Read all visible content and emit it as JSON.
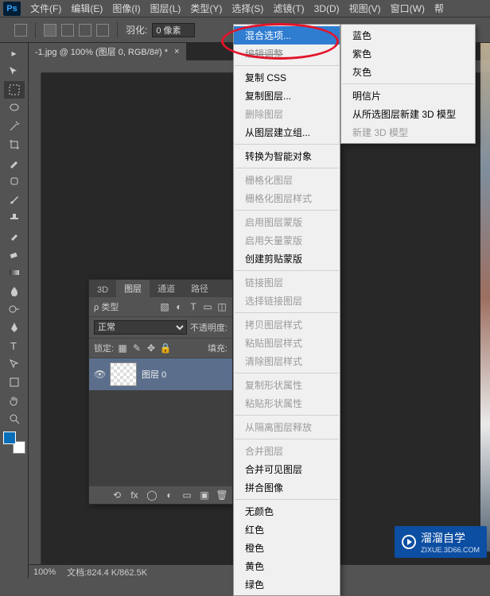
{
  "menubar": {
    "items": [
      "文件(F)",
      "编辑(E)",
      "图像(I)",
      "图层(L)",
      "类型(Y)",
      "选择(S)",
      "滤镜(T)",
      "3D(D)",
      "视图(V)",
      "窗口(W)",
      "帮"
    ]
  },
  "optbar": {
    "feather_label": "羽化:",
    "feather_value": "0 像素"
  },
  "doc": {
    "tab_title": "-1.jpg @ 100% (图层 0, RGB/8#) *"
  },
  "layers_panel": {
    "tabs": [
      "3D",
      "图层",
      "通道",
      "路径"
    ],
    "active_tab": 1,
    "kind_label": "ρ 类型",
    "blend_label": "正常",
    "opacity_label": "不透明度:",
    "lock_label": "锁定:",
    "fill_label": "填充:",
    "layer0_name": "图层 0"
  },
  "statusbar": {
    "zoom": "100%",
    "docinfo_label": "文档:",
    "docinfo_value": "824.4 K/862.5K"
  },
  "ctx_left": {
    "highlight": "混合选项...",
    "cutoff": "编辑调整",
    "items": [
      {
        "t": "复制 CSS",
        "d": false
      },
      {
        "t": "复制图层...",
        "d": false
      },
      {
        "t": "删除图层",
        "d": true
      },
      {
        "t": "从图层建立组...",
        "d": false
      },
      {
        "sep": true
      },
      {
        "t": "转换为智能对象",
        "d": false
      },
      {
        "sep": true
      },
      {
        "t": "栅格化图层",
        "d": true
      },
      {
        "t": "栅格化图层样式",
        "d": true
      },
      {
        "sep": true
      },
      {
        "t": "启用图层蒙版",
        "d": true
      },
      {
        "t": "启用矢量蒙版",
        "d": true
      },
      {
        "t": "创建剪贴蒙版",
        "d": false
      },
      {
        "sep": true
      },
      {
        "t": "链接图层",
        "d": true
      },
      {
        "t": "选择链接图层",
        "d": true
      },
      {
        "sep": true
      },
      {
        "t": "拷贝图层样式",
        "d": true
      },
      {
        "t": "粘贴图层样式",
        "d": true
      },
      {
        "t": "清除图层样式",
        "d": true
      },
      {
        "sep": true
      },
      {
        "t": "复制形状属性",
        "d": true
      },
      {
        "t": "粘贴形状属性",
        "d": true
      },
      {
        "sep": true
      },
      {
        "t": "从隔离图层释放",
        "d": true
      },
      {
        "sep": true
      },
      {
        "t": "合并图层",
        "d": true
      },
      {
        "t": "合并可见图层",
        "d": false
      },
      {
        "t": "拼合图像",
        "d": false
      },
      {
        "sep": true
      },
      {
        "t": "无颜色",
        "d": false
      },
      {
        "t": "红色",
        "d": false
      },
      {
        "t": "橙色",
        "d": false
      },
      {
        "t": "黄色",
        "d": false
      },
      {
        "t": "绿色",
        "d": false
      }
    ]
  },
  "ctx_right": {
    "items": [
      {
        "t": "蓝色",
        "d": false
      },
      {
        "t": "紫色",
        "d": false
      },
      {
        "t": "灰色",
        "d": false
      },
      {
        "sep": true
      },
      {
        "t": "明信片",
        "d": false
      },
      {
        "t": "从所选图层新建 3D 模型",
        "d": false
      },
      {
        "t": "新建 3D 模型",
        "d": true
      }
    ]
  },
  "watermark": {
    "main": "溜溜自学",
    "sub": "ZIXUE.3D66.COM"
  }
}
